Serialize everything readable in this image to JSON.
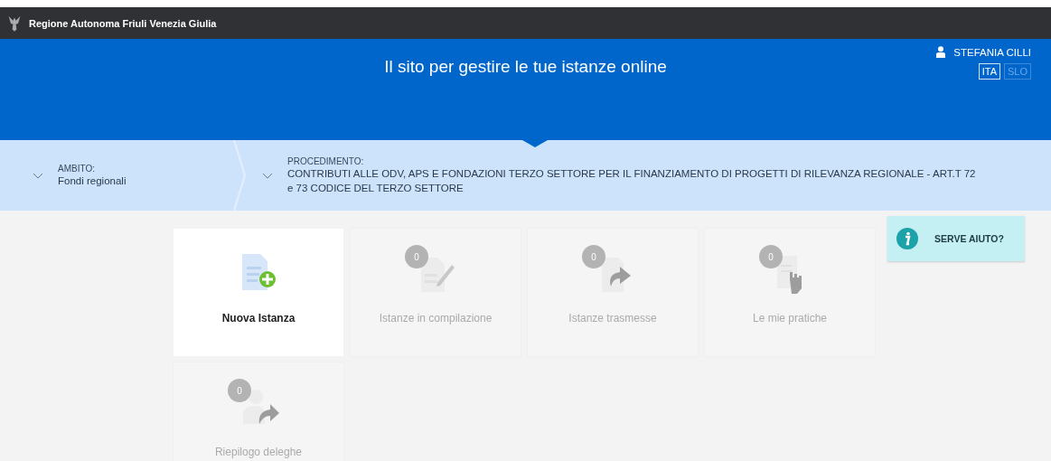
{
  "topbar": {
    "title": "Regione Autonoma Friuli Venezia Giulia"
  },
  "header": {
    "title": "Il sito per gestire le tue istanze online",
    "user": "STEFANIA CILLI",
    "languages": [
      {
        "label": "ITA",
        "selected": true
      },
      {
        "label": "SLO",
        "selected": false
      }
    ]
  },
  "breadcrumb": [
    {
      "label": "AMBITO:",
      "value": "Fondi regionali"
    },
    {
      "label": "PROCEDIMENTO:",
      "value": "CONTRIBUTI ALLE ODV, APS E FONDAZIONI TERZO SETTORE PER IL FINANZIAMENTO DI PROGETTI DI RILEVANZA REGIONALE - ART.T 72 e 73 CODICE DEL TERZO SETTORE"
    }
  ],
  "tiles": [
    {
      "kind": "new",
      "label": "Nuova Istanza",
      "disabled": false
    },
    {
      "kind": "edit",
      "label": "Istanze in compilazione",
      "count": "0",
      "disabled": true
    },
    {
      "kind": "send",
      "label": "Istanze trasmesse",
      "count": "0",
      "disabled": true
    },
    {
      "kind": "hand",
      "label": "Le mie pratiche",
      "count": "0",
      "disabled": true
    },
    {
      "kind": "delegate",
      "label": "Riepilogo deleghe",
      "count": "0",
      "disabled": true
    }
  ],
  "help": {
    "label": "SERVE AIUTO?"
  }
}
